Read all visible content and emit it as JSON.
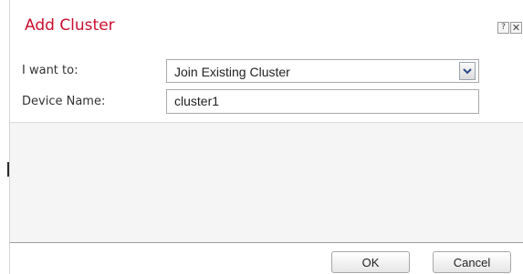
{
  "dialog": {
    "title": "Add Cluster",
    "help_label": "?",
    "close_label": "✕"
  },
  "form": {
    "i_want_to_label": "I want to:",
    "i_want_to_value": "Join Existing Cluster",
    "device_name_label": "Device Name:",
    "device_name_value": "cluster1"
  },
  "footer": {
    "ok_label": "OK",
    "cancel_label": "Cancel"
  },
  "colors": {
    "title": "#c8102e"
  }
}
